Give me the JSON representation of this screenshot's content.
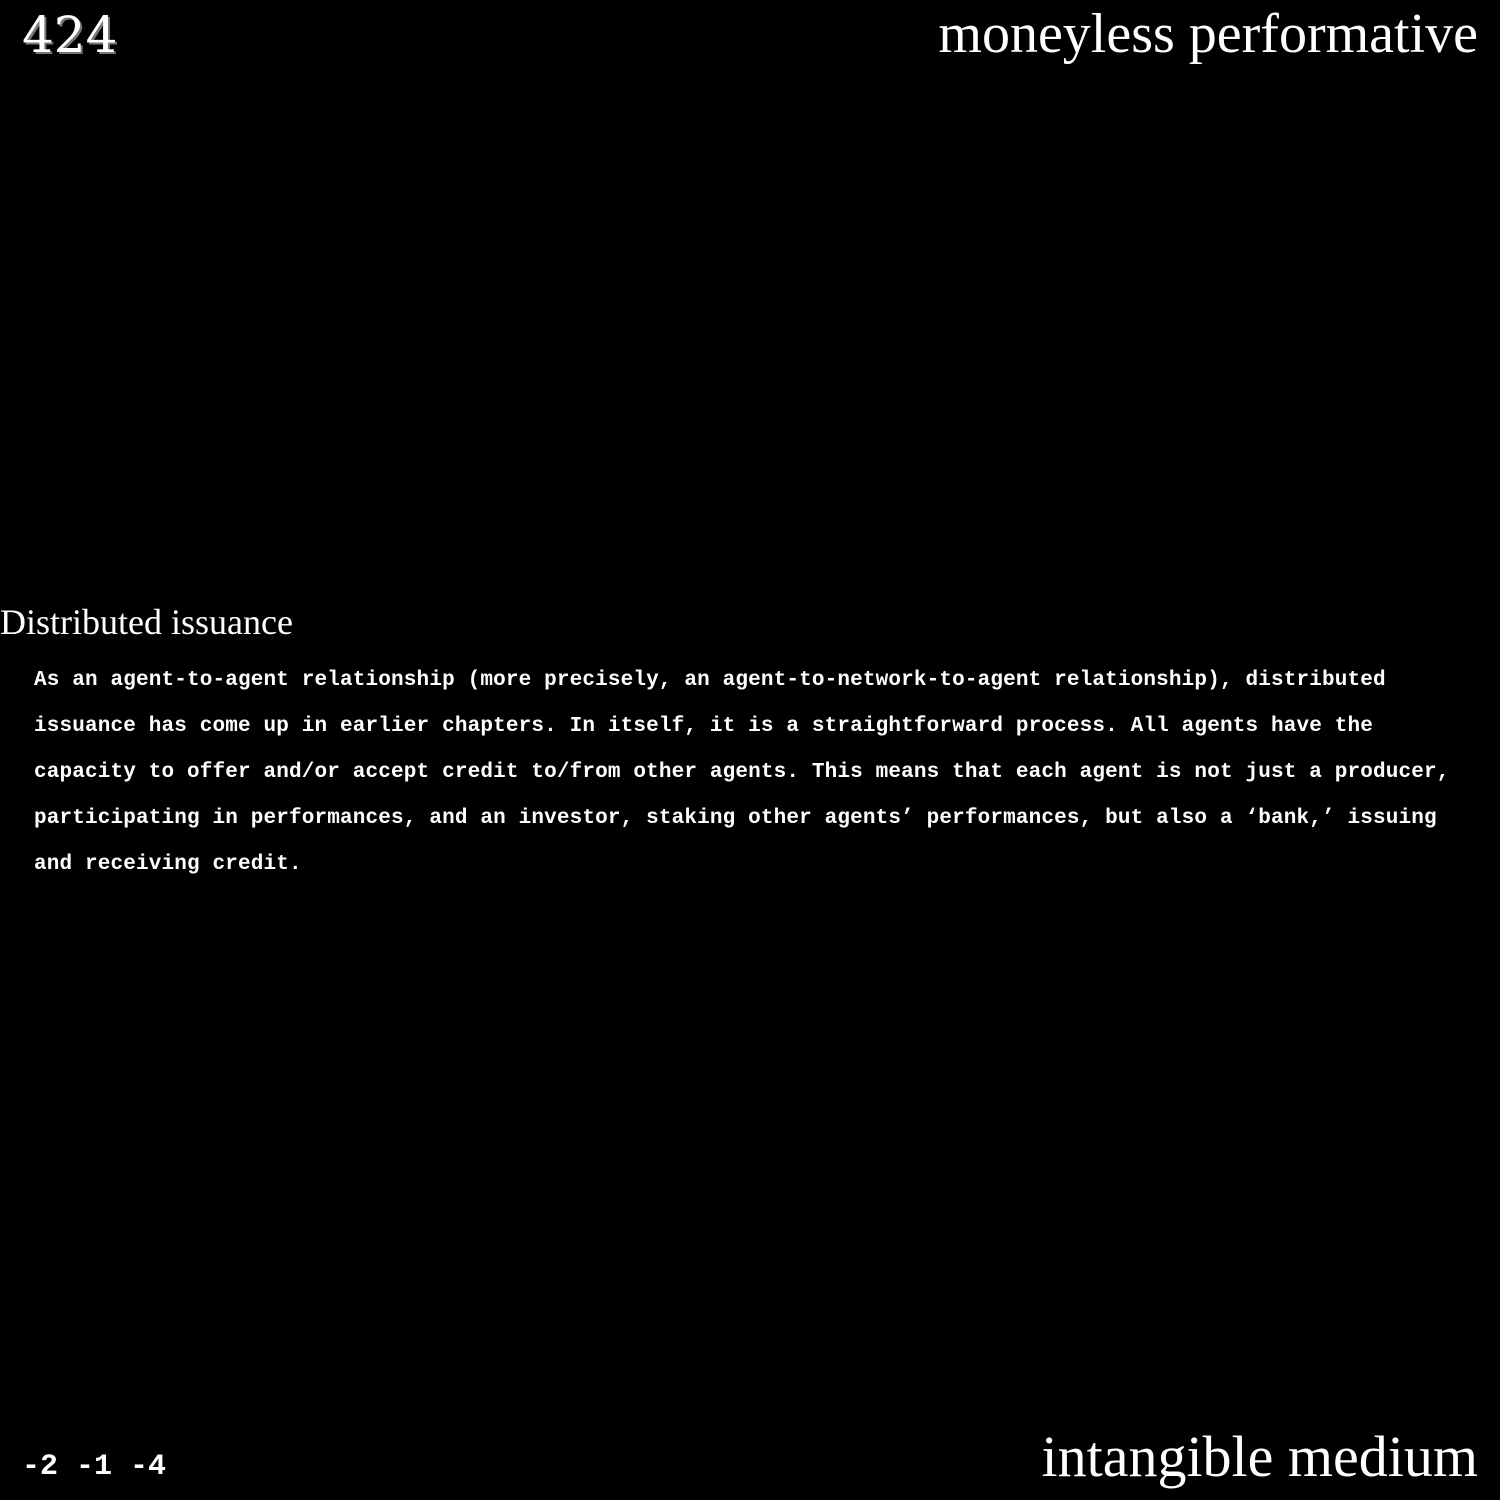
{
  "header": {
    "page_number": "424",
    "running_title": "moneyless performative"
  },
  "section": {
    "heading": "Distributed issuance",
    "body": "As an agent-to-agent relationship (more precisely, an agent-to-network-to-agent relationship), distributed issuance has come up in earlier chapters. In itself, it is a straightforward process. All agents have the capacity to offer and/or accept credit to/from other agents. This means that each agent is not just a producer, participating in performances, and an investor, staking other agents’ performances, but also a ‘bank,’ issuing and receiving credit."
  },
  "footer": {
    "coordinates": "-2 -1 -4",
    "title": "intangible medium"
  },
  "colors": {
    "background": "#000000",
    "text": "#ffffff"
  }
}
